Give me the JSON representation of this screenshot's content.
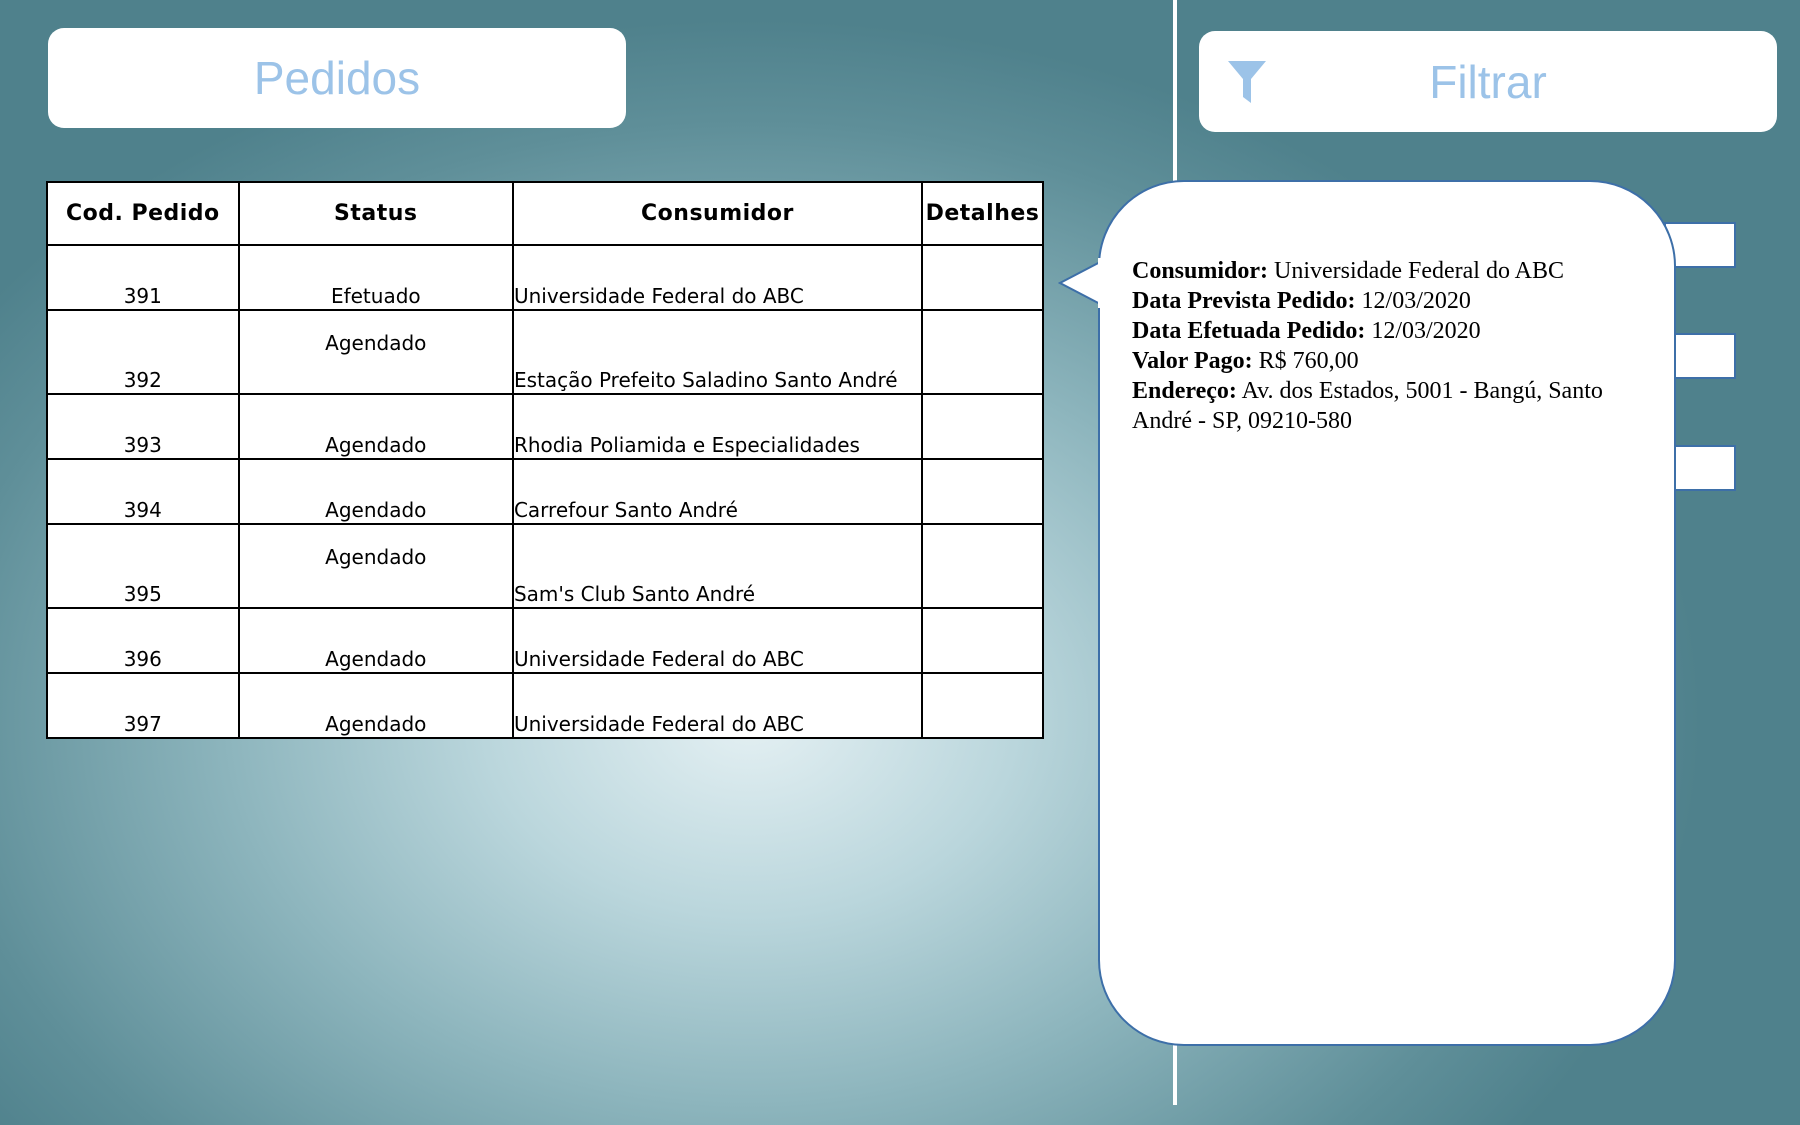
{
  "header": {
    "title": "Pedidos"
  },
  "filter": {
    "label": "Filtrar",
    "icon": "filter-icon"
  },
  "table": {
    "columns": [
      "Cod. Pedido",
      "Status",
      "Consumidor",
      "Detalhes"
    ],
    "rows": [
      {
        "cod": "391",
        "status": "Efetuado",
        "consumidor": "Universidade Federal do ABC",
        "detalhes": ""
      },
      {
        "cod": "392",
        "status": "Agendado",
        "consumidor": "Estação Prefeito Saladino Santo André",
        "detalhes": ""
      },
      {
        "cod": "393",
        "status": "Agendado",
        "consumidor": "Rhodia Poliamida e Especialidades",
        "detalhes": ""
      },
      {
        "cod": "394",
        "status": "Agendado",
        "consumidor": "Carrefour Santo André",
        "detalhes": ""
      },
      {
        "cod": "395",
        "status": "Agendado",
        "consumidor": "Sam's Club Santo André",
        "detalhes": ""
      },
      {
        "cod": "396",
        "status": "Agendado",
        "consumidor": "Universidade Federal do ABC",
        "detalhes": ""
      },
      {
        "cod": "397",
        "status": "Agendado",
        "consumidor": "Universidade Federal do ABC",
        "detalhes": ""
      }
    ]
  },
  "details": {
    "consumidor_label": "Consumidor:",
    "consumidor_value": "Universidade Federal do ABC",
    "data_prevista_label": "Data Prevista Pedido:",
    "data_prevista_value": "12/03/2020",
    "data_efetuada_label": "Data Efetuada Pedido:",
    "data_efetuada_value": "12/03/2020",
    "valor_label": "Valor Pago:",
    "valor_value": "R$ 760,00",
    "endereco_label": "Endereço:",
    "endereco_value": "Av. dos Estados, 5001 - Bangú, Santo André - SP, 09210-580"
  },
  "colors": {
    "title_text": "#9cc3e8",
    "tooltip_border": "#3d6fa8",
    "background": "#5f8f99"
  }
}
